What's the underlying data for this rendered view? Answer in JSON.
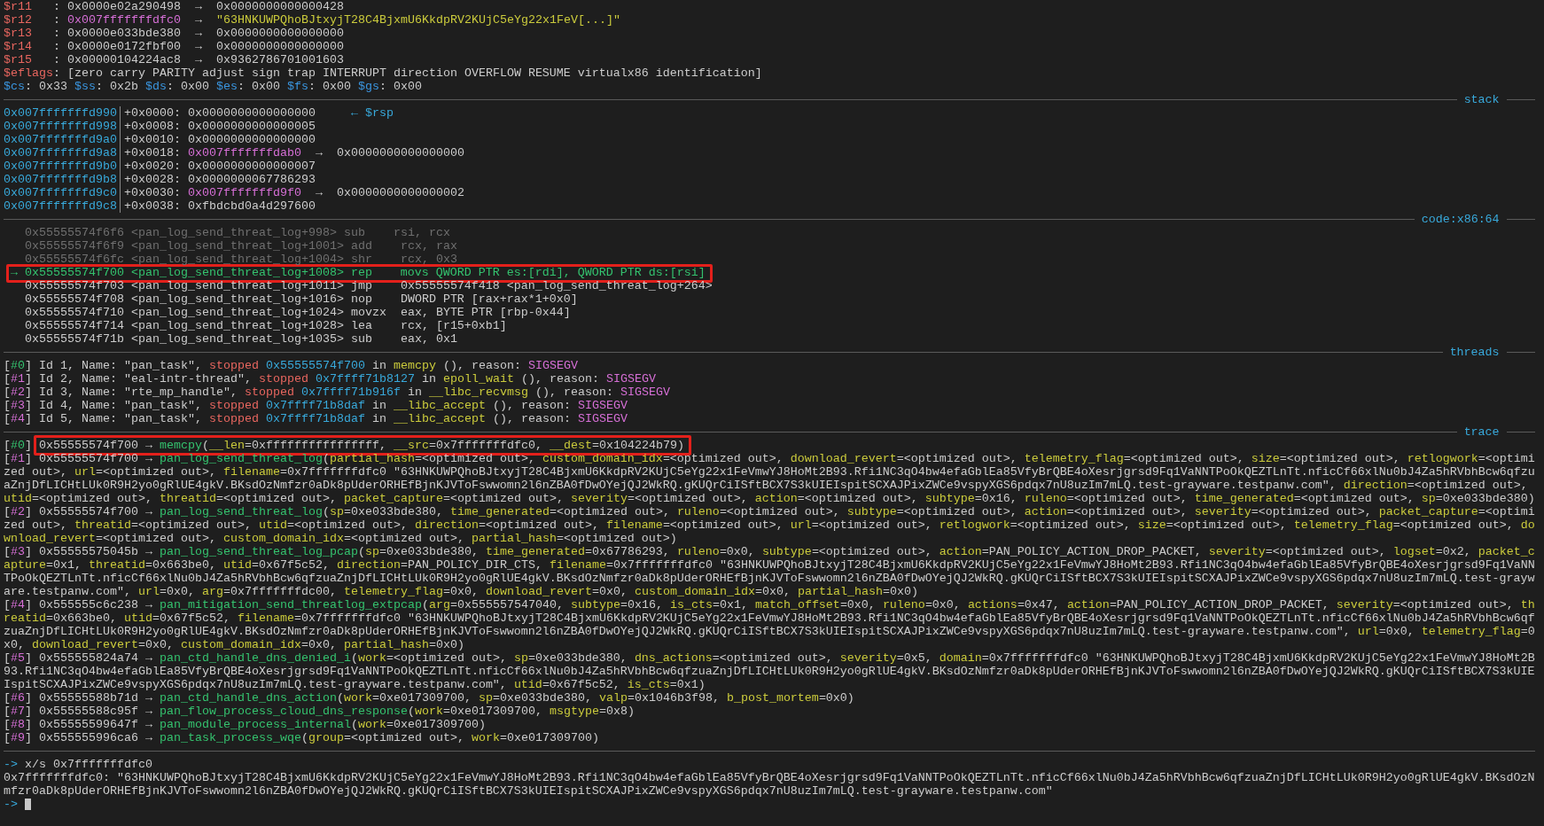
{
  "registers": [
    {
      "name": "$r11",
      "changed": true,
      "segments": [
        {
          "kind": "text",
          "text": "   : 0x0000e02a290498  →  0x0000000000000428"
        }
      ]
    },
    {
      "name": "$r12",
      "changed": true,
      "segments": [
        {
          "kind": "text",
          "text": "   : "
        },
        {
          "kind": "pointer",
          "text": "0x007fffffffdfc0"
        },
        {
          "kind": "text",
          "text": "  →  "
        },
        {
          "kind": "string",
          "text": "\"63HNKUWPQhoBJtxyjT28C4BjxmU6KkdpRV2KUjC5eYg22x1FeV[...]\""
        }
      ]
    },
    {
      "name": "$r13",
      "changed": true,
      "segments": [
        {
          "kind": "text",
          "text": "   : 0x0000e033bde380  →  0x0000000000000000"
        }
      ]
    },
    {
      "name": "$r14",
      "changed": true,
      "segments": [
        {
          "kind": "text",
          "text": "   : 0x0000e0172fbf00  →  0x0000000000000000"
        }
      ]
    },
    {
      "name": "$r15",
      "changed": true,
      "segments": [
        {
          "kind": "text",
          "text": "   : 0x00000104224ac8  →  0x9362786701001603"
        }
      ]
    },
    {
      "name": "$eflags",
      "changed": true,
      "segments": [
        {
          "kind": "text",
          "text": ": [zero carry PARITY adjust sign trap INTERRUPT direction OVERFLOW RESUME virtualx86 identification]"
        }
      ]
    }
  ],
  "segment_registers": [
    {
      "name": "$cs",
      "changed": false,
      "value": ": 0x33"
    },
    {
      "name": "$ss",
      "changed": false,
      "value": ": 0x2b"
    },
    {
      "name": "$ds",
      "changed": false,
      "value": ": 0x00"
    },
    {
      "name": "$es",
      "changed": false,
      "value": ": 0x00"
    },
    {
      "name": "$fs",
      "changed": false,
      "value": ": 0x00"
    },
    {
      "name": "$gs",
      "changed": false,
      "value": ": 0x00"
    }
  ],
  "stack": {
    "title": "stack",
    "rows": [
      {
        "address": "0x007fffffffd990",
        "segments": [
          {
            "kind": "text",
            "text": "+0x0000: 0x0000000000000000"
          },
          {
            "kind": "hint",
            "text": "     ← $rsp"
          }
        ]
      },
      {
        "address": "0x007fffffffd998",
        "segments": [
          {
            "kind": "text",
            "text": "+0x0008: 0x0000000000000005"
          }
        ]
      },
      {
        "address": "0x007fffffffd9a0",
        "segments": [
          {
            "kind": "text",
            "text": "+0x0010: 0x0000000000000000"
          }
        ]
      },
      {
        "address": "0x007fffffffd9a8",
        "segments": [
          {
            "kind": "text",
            "text": "+0x0018: "
          },
          {
            "kind": "pointer",
            "text": "0x007fffffffdab0"
          },
          {
            "kind": "text",
            "text": "  →  0x0000000000000000"
          }
        ]
      },
      {
        "address": "0x007fffffffd9b0",
        "segments": [
          {
            "kind": "text",
            "text": "+0x0020: 0x0000000000000007"
          }
        ]
      },
      {
        "address": "0x007fffffffd9b8",
        "segments": [
          {
            "kind": "text",
            "text": "+0x0028: 0x0000000067786293"
          }
        ]
      },
      {
        "address": "0x007fffffffd9c0",
        "segments": [
          {
            "kind": "text",
            "text": "+0x0030: "
          },
          {
            "kind": "pointer",
            "text": "0x007fffffffd9f0"
          },
          {
            "kind": "text",
            "text": "  →  0x0000000000000002"
          }
        ]
      },
      {
        "address": "0x007fffffffd9c8",
        "segments": [
          {
            "kind": "text",
            "text": "+0x0038: 0xfbdcbd0a4d297600"
          }
        ]
      }
    ]
  },
  "code": {
    "title": "code:x86:64",
    "lines": [
      {
        "executed": true,
        "current": false,
        "highlighted": false,
        "text": "0x55555574f6f6 <pan_log_send_threat_log+998> sub    rsi, rcx"
      },
      {
        "executed": true,
        "current": false,
        "highlighted": false,
        "text": "0x55555574f6f9 <pan_log_send_threat_log+1001> add    rcx, rax"
      },
      {
        "executed": true,
        "current": false,
        "highlighted": false,
        "text": "0x55555574f6fc <pan_log_send_threat_log+1004> shr    rcx, 0x3"
      },
      {
        "executed": false,
        "current": true,
        "highlighted": true,
        "marker": "→",
        "text": "0x55555574f700 <pan_log_send_threat_log+1008> rep    movs QWORD PTR es:[rdi], QWORD PTR ds:[rsi]"
      },
      {
        "executed": false,
        "current": false,
        "highlighted": false,
        "text": "0x55555574f703 <pan_log_send_threat_log+1011> jmp    0x55555574f418 <pan_log_send_threat_log+264>"
      },
      {
        "executed": false,
        "current": false,
        "highlighted": false,
        "text": "0x55555574f708 <pan_log_send_threat_log+1016> nop    DWORD PTR [rax+rax*1+0x0]"
      },
      {
        "executed": false,
        "current": false,
        "highlighted": false,
        "text": "0x55555574f710 <pan_log_send_threat_log+1024> movzx  eax, BYTE PTR [rbp-0x44]"
      },
      {
        "executed": false,
        "current": false,
        "highlighted": false,
        "text": "0x55555574f714 <pan_log_send_threat_log+1028> lea    rcx, [r15+0xb1]"
      },
      {
        "executed": false,
        "current": false,
        "highlighted": false,
        "text": "0x55555574f71b <pan_log_send_threat_log+1035> sub    eax, 0x1"
      }
    ]
  },
  "threads": {
    "title": "threads",
    "lines": [
      {
        "selected": true,
        "index": [
          {
            "kind": "text",
            "text": "["
          },
          {
            "kind": "index",
            "text": "#0"
          },
          {
            "kind": "text",
            "text": "]"
          }
        ],
        "segments": [
          {
            "kind": "text",
            "text": "Id 1, Name: \"pan_task\", "
          },
          {
            "kind": "status",
            "text": "stopped"
          },
          {
            "kind": "address",
            "text": " 0x55555574f700"
          },
          {
            "kind": "text",
            "text": " in "
          },
          {
            "kind": "function",
            "text": "memcpy"
          },
          {
            "kind": "text",
            "text": " (), reason: "
          },
          {
            "kind": "signal",
            "text": "SIGSEGV"
          }
        ]
      },
      {
        "selected": false,
        "index": [
          {
            "kind": "text",
            "text": "["
          },
          {
            "kind": "index",
            "text": "#1"
          },
          {
            "kind": "text",
            "text": "]"
          }
        ],
        "segments": [
          {
            "kind": "text",
            "text": "Id 2, Name: \"eal-intr-thread\", "
          },
          {
            "kind": "status",
            "text": "stopped"
          },
          {
            "kind": "address",
            "text": " 0x7ffff71b8127"
          },
          {
            "kind": "text",
            "text": " in "
          },
          {
            "kind": "function",
            "text": "epoll_wait"
          },
          {
            "kind": "text",
            "text": " (), reason: "
          },
          {
            "kind": "signal",
            "text": "SIGSEGV"
          }
        ]
      },
      {
        "selected": false,
        "index": [
          {
            "kind": "text",
            "text": "["
          },
          {
            "kind": "index",
            "text": "#2"
          },
          {
            "kind": "text",
            "text": "]"
          }
        ],
        "segments": [
          {
            "kind": "text",
            "text": "Id 3, Name: \"rte_mp_handle\", "
          },
          {
            "kind": "status",
            "text": "stopped"
          },
          {
            "kind": "address",
            "text": " 0x7ffff71b916f"
          },
          {
            "kind": "text",
            "text": " in "
          },
          {
            "kind": "function",
            "text": "__libc_recvmsg"
          },
          {
            "kind": "text",
            "text": " (), reason: "
          },
          {
            "kind": "signal",
            "text": "SIGSEGV"
          }
        ]
      },
      {
        "selected": false,
        "index": [
          {
            "kind": "text",
            "text": "["
          },
          {
            "kind": "index",
            "text": "#3"
          },
          {
            "kind": "text",
            "text": "]"
          }
        ],
        "segments": [
          {
            "kind": "text",
            "text": "Id 4, Name: \"pan_task\", "
          },
          {
            "kind": "status",
            "text": "stopped"
          },
          {
            "kind": "address",
            "text": " 0x7ffff71b8daf"
          },
          {
            "kind": "text",
            "text": " in "
          },
          {
            "kind": "function",
            "text": "__libc_accept"
          },
          {
            "kind": "text",
            "text": " (), reason: "
          },
          {
            "kind": "signal",
            "text": "SIGSEGV"
          }
        ]
      },
      {
        "selected": false,
        "index": [
          {
            "kind": "text",
            "text": "["
          },
          {
            "kind": "index",
            "text": "#4"
          },
          {
            "kind": "text",
            "text": "]"
          }
        ],
        "segments": [
          {
            "kind": "text",
            "text": "Id 5, Name: \"pan_task\", "
          },
          {
            "kind": "status",
            "text": "stopped"
          },
          {
            "kind": "address",
            "text": " 0x7ffff71b8daf"
          },
          {
            "kind": "text",
            "text": " in "
          },
          {
            "kind": "function",
            "text": "__libc_accept"
          },
          {
            "kind": "text",
            "text": " (), reason: "
          },
          {
            "kind": "signal",
            "text": "SIGSEGV"
          }
        ]
      }
    ]
  },
  "trace": {
    "title": "trace",
    "frames": [
      {
        "selected": true,
        "highlighted": true,
        "segments": [
          {
            "kind": "text",
            "text": "["
          },
          {
            "kind": "index",
            "text": "#0"
          },
          {
            "kind": "text",
            "text": "] 0x55555574f700 → "
          },
          {
            "kind": "function",
            "text": "memcpy"
          },
          {
            "kind": "text",
            "text": "("
          },
          {
            "kind": "param",
            "text": "__len"
          },
          {
            "kind": "text",
            "text": "=0xffffffffffffffff, "
          },
          {
            "kind": "param",
            "text": "__src"
          },
          {
            "kind": "text",
            "text": "=0x7fffffffdfc0, "
          },
          {
            "kind": "param",
            "text": "__dest"
          },
          {
            "kind": "text",
            "text": "=0x104224b79)"
          }
        ]
      },
      {
        "selected": false,
        "highlighted": false,
        "segments": [
          {
            "kind": "text",
            "text": "["
          },
          {
            "kind": "index",
            "text": "#1"
          },
          {
            "kind": "text",
            "text": "] 0x55555574f700 → "
          },
          {
            "kind": "function",
            "text": "pan_log_send_threat_log"
          },
          {
            "kind": "text",
            "text": "("
          },
          {
            "kind": "param",
            "text": "partial_hash"
          },
          {
            "kind": "text",
            "text": "=<optimized out>, "
          },
          {
            "kind": "param",
            "text": "custom_domain_idx"
          },
          {
            "kind": "text",
            "text": "=<optimized out>, "
          },
          {
            "kind": "param",
            "text": "download_revert"
          },
          {
            "kind": "text",
            "text": "=<optimized out>, "
          },
          {
            "kind": "param",
            "text": "telemetry_flag"
          },
          {
            "kind": "text",
            "text": "=<optimized out>, "
          },
          {
            "kind": "param",
            "text": "size"
          },
          {
            "kind": "text",
            "text": "=<optimized out>, "
          },
          {
            "kind": "param",
            "text": "retlogwork"
          },
          {
            "kind": "text",
            "text": "=<optimized out>, "
          },
          {
            "kind": "param",
            "text": "url"
          },
          {
            "kind": "text",
            "text": "=<optimized out>, "
          },
          {
            "kind": "param",
            "text": "filename"
          },
          {
            "kind": "text",
            "text": "=0x7fffffffdfc0 \"63HNKUWPQhoBJtxyjT28C4BjxmU6KkdpRV2KUjC5eYg22x1FeVmwYJ8HoMt2B93.Rfi1NC3qO4bw4efaGblEa85VfyBrQBE4oXesrjgrsd9Fq1VaNNTPoOkQEZTLnTt.nficCf66xlNu0bJ4Za5hRVbhBcw6qfzuaZnjDfLICHtLUk0R9H2yo0gRlUE4gkV.BKsdOzNmfzr0aDk8pUderORHEfBjnKJVToFswwomn2l6nZBA0fDwOYejQJ2WkRQ.gKUQrCiISftBCX7S3kUIEIspitSCXAJPixZWCe9vspyXGS6pdqx7nU8uzIm7mLQ.test-grayware.testpanw.com\", "
          },
          {
            "kind": "param",
            "text": "direction"
          },
          {
            "kind": "text",
            "text": "=<optimized out>, "
          },
          {
            "kind": "param",
            "text": "utid"
          },
          {
            "kind": "text",
            "text": "=<optimized out>, "
          },
          {
            "kind": "param",
            "text": "threatid"
          },
          {
            "kind": "text",
            "text": "=<optimized out>, "
          },
          {
            "kind": "param",
            "text": "packet_capture"
          },
          {
            "kind": "text",
            "text": "=<optimized out>, "
          },
          {
            "kind": "param",
            "text": "severity"
          },
          {
            "kind": "text",
            "text": "=<optimized out>, "
          },
          {
            "kind": "param",
            "text": "action"
          },
          {
            "kind": "text",
            "text": "=<optimized out>, "
          },
          {
            "kind": "param",
            "text": "subtype"
          },
          {
            "kind": "text",
            "text": "=0x16, "
          },
          {
            "kind": "param",
            "text": "ruleno"
          },
          {
            "kind": "text",
            "text": "=<optimized out>, "
          },
          {
            "kind": "param",
            "text": "time_generated"
          },
          {
            "kind": "text",
            "text": "=<optimized out>, "
          },
          {
            "kind": "param",
            "text": "sp"
          },
          {
            "kind": "text",
            "text": "=0xe033bde380)"
          }
        ]
      },
      {
        "selected": false,
        "highlighted": false,
        "segments": [
          {
            "kind": "text",
            "text": "["
          },
          {
            "kind": "index",
            "text": "#2"
          },
          {
            "kind": "text",
            "text": "] 0x55555574f700 → "
          },
          {
            "kind": "function",
            "text": "pan_log_send_threat_log"
          },
          {
            "kind": "text",
            "text": "("
          },
          {
            "kind": "param",
            "text": "sp"
          },
          {
            "kind": "text",
            "text": "=0xe033bde380, "
          },
          {
            "kind": "param",
            "text": "time_generated"
          },
          {
            "kind": "text",
            "text": "=<optimized out>, "
          },
          {
            "kind": "param",
            "text": "ruleno"
          },
          {
            "kind": "text",
            "text": "=<optimized out>, "
          },
          {
            "kind": "param",
            "text": "subtype"
          },
          {
            "kind": "text",
            "text": "=<optimized out>, "
          },
          {
            "kind": "param",
            "text": "action"
          },
          {
            "kind": "text",
            "text": "=<optimized out>, "
          },
          {
            "kind": "param",
            "text": "severity"
          },
          {
            "kind": "text",
            "text": "=<optimized out>, "
          },
          {
            "kind": "param",
            "text": "packet_capture"
          },
          {
            "kind": "text",
            "text": "=<optimized out>, "
          },
          {
            "kind": "param",
            "text": "threatid"
          },
          {
            "kind": "text",
            "text": "=<optimized out>, "
          },
          {
            "kind": "param",
            "text": "utid"
          },
          {
            "kind": "text",
            "text": "=<optimized out>, "
          },
          {
            "kind": "param",
            "text": "direction"
          },
          {
            "kind": "text",
            "text": "=<optimized out>, "
          },
          {
            "kind": "param",
            "text": "filename"
          },
          {
            "kind": "text",
            "text": "=<optimized out>, "
          },
          {
            "kind": "param",
            "text": "url"
          },
          {
            "kind": "text",
            "text": "=<optimized out>, "
          },
          {
            "kind": "param",
            "text": "retlogwork"
          },
          {
            "kind": "text",
            "text": "=<optimized out>, "
          },
          {
            "kind": "param",
            "text": "size"
          },
          {
            "kind": "text",
            "text": "=<optimized out>, "
          },
          {
            "kind": "param",
            "text": "telemetry_flag"
          },
          {
            "kind": "text",
            "text": "=<optimized out>, "
          },
          {
            "kind": "param",
            "text": "download_revert"
          },
          {
            "kind": "text",
            "text": "=<optimized out>, "
          },
          {
            "kind": "param",
            "text": "custom_domain_idx"
          },
          {
            "kind": "text",
            "text": "=<optimized out>, "
          },
          {
            "kind": "param",
            "text": "partial_hash"
          },
          {
            "kind": "text",
            "text": "=<optimized out>)"
          }
        ]
      },
      {
        "selected": false,
        "highlighted": false,
        "segments": [
          {
            "kind": "text",
            "text": "["
          },
          {
            "kind": "index",
            "text": "#3"
          },
          {
            "kind": "text",
            "text": "] 0x55555575045b → "
          },
          {
            "kind": "function",
            "text": "pan_log_send_threat_log_pcap"
          },
          {
            "kind": "text",
            "text": "("
          },
          {
            "kind": "param",
            "text": "sp"
          },
          {
            "kind": "text",
            "text": "=0xe033bde380, "
          },
          {
            "kind": "param",
            "text": "time_generated"
          },
          {
            "kind": "text",
            "text": "=0x67786293, "
          },
          {
            "kind": "param",
            "text": "ruleno"
          },
          {
            "kind": "text",
            "text": "=0x0, "
          },
          {
            "kind": "param",
            "text": "subtype"
          },
          {
            "kind": "text",
            "text": "=<optimized out>, "
          },
          {
            "kind": "param",
            "text": "action"
          },
          {
            "kind": "text",
            "text": "=PAN_POLICY_ACTION_DROP_PACKET, "
          },
          {
            "kind": "param",
            "text": "severity"
          },
          {
            "kind": "text",
            "text": "=<optimized out>, "
          },
          {
            "kind": "param",
            "text": "logset"
          },
          {
            "kind": "text",
            "text": "=0x2, "
          },
          {
            "kind": "param",
            "text": "packet_capture"
          },
          {
            "kind": "text",
            "text": "=0x1, "
          },
          {
            "kind": "param",
            "text": "threatid"
          },
          {
            "kind": "text",
            "text": "=0x663be0, "
          },
          {
            "kind": "param",
            "text": "utid"
          },
          {
            "kind": "text",
            "text": "=0x67f5c52, "
          },
          {
            "kind": "param",
            "text": "direction"
          },
          {
            "kind": "text",
            "text": "=PAN_POLICY_DIR_CTS, "
          },
          {
            "kind": "param",
            "text": "filename"
          },
          {
            "kind": "text",
            "text": "=0x7fffffffdfc0 \"63HNKUWPQhoBJtxyjT28C4BjxmU6KkdpRV2KUjC5eYg22x1FeVmwYJ8HoMt2B93.Rfi1NC3qO4bw4efaGblEa85VfyBrQBE4oXesrjgrsd9Fq1VaNNTPoOkQEZTLnTt.nficCf66xlNu0bJ4Za5hRVbhBcw6qfzuaZnjDfLICHtLUk0R9H2yo0gRlUE4gkV.BKsdOzNmfzr0aDk8pUderORHEfBjnKJVToFswwomn2l6nZBA0fDwOYejQJ2WkRQ.gKUQrCiISftBCX7S3kUIEIspitSCXAJPixZWCe9vspyXGS6pdqx7nU8uzIm7mLQ.test-grayware.testpanw.com\", "
          },
          {
            "kind": "param",
            "text": "url"
          },
          {
            "kind": "text",
            "text": "=0x0, "
          },
          {
            "kind": "param",
            "text": "arg"
          },
          {
            "kind": "text",
            "text": "=0x7fffffffdc00, "
          },
          {
            "kind": "param",
            "text": "telemetry_flag"
          },
          {
            "kind": "text",
            "text": "=0x0, "
          },
          {
            "kind": "param",
            "text": "download_revert"
          },
          {
            "kind": "text",
            "text": "=0x0, "
          },
          {
            "kind": "param",
            "text": "custom_domain_idx"
          },
          {
            "kind": "text",
            "text": "=0x0, "
          },
          {
            "kind": "param",
            "text": "partial_hash"
          },
          {
            "kind": "text",
            "text": "=0x0)"
          }
        ]
      },
      {
        "selected": false,
        "highlighted": false,
        "segments": [
          {
            "kind": "text",
            "text": "["
          },
          {
            "kind": "index",
            "text": "#4"
          },
          {
            "kind": "text",
            "text": "] 0x555555c6c238 → "
          },
          {
            "kind": "function",
            "text": "pan_mitigation_send_threatlog_extpcap"
          },
          {
            "kind": "text",
            "text": "("
          },
          {
            "kind": "param",
            "text": "arg"
          },
          {
            "kind": "text",
            "text": "=0x555557547040, "
          },
          {
            "kind": "param",
            "text": "subtype"
          },
          {
            "kind": "text",
            "text": "=0x16, "
          },
          {
            "kind": "param",
            "text": "is_cts"
          },
          {
            "kind": "text",
            "text": "=0x1, "
          },
          {
            "kind": "param",
            "text": "match_offset"
          },
          {
            "kind": "text",
            "text": "=0x0, "
          },
          {
            "kind": "param",
            "text": "ruleno"
          },
          {
            "kind": "text",
            "text": "=0x0, "
          },
          {
            "kind": "param",
            "text": "actions"
          },
          {
            "kind": "text",
            "text": "=0x47, "
          },
          {
            "kind": "param",
            "text": "action"
          },
          {
            "kind": "text",
            "text": "=PAN_POLICY_ACTION_DROP_PACKET, "
          },
          {
            "kind": "param",
            "text": "severity"
          },
          {
            "kind": "text",
            "text": "=<optimized out>, "
          },
          {
            "kind": "param",
            "text": "threatid"
          },
          {
            "kind": "text",
            "text": "=0x663be0, "
          },
          {
            "kind": "param",
            "text": "utid"
          },
          {
            "kind": "text",
            "text": "=0x67f5c52, "
          },
          {
            "kind": "param",
            "text": "filename"
          },
          {
            "kind": "text",
            "text": "=0x7fffffffdfc0 \"63HNKUWPQhoBJtxyjT28C4BjxmU6KkdpRV2KUjC5eYg22x1FeVmwYJ8HoMt2B93.Rfi1NC3qO4bw4efaGblEa85VfyBrQBE4oXesrjgrsd9Fq1VaNNTPoOkQEZTLnTt.nficCf66xlNu0bJ4Za5hRVbhBcw6qfzuaZnjDfLICHtLUk0R9H2yo0gRlUE4gkV.BKsdOzNmfzr0aDk8pUderORHEfBjnKJVToFswwomn2l6nZBA0fDwOYejQJ2WkRQ.gKUQrCiISftBCX7S3kUIEIspitSCXAJPixZWCe9vspyXGS6pdqx7nU8uzIm7mLQ.test-grayware.testpanw.com\", "
          },
          {
            "kind": "param",
            "text": "url"
          },
          {
            "kind": "text",
            "text": "=0x0, "
          },
          {
            "kind": "param",
            "text": "telemetry_flag"
          },
          {
            "kind": "text",
            "text": "=0x0, "
          },
          {
            "kind": "param",
            "text": "download_revert"
          },
          {
            "kind": "text",
            "text": "=0x0, "
          },
          {
            "kind": "param",
            "text": "custom_domain_idx"
          },
          {
            "kind": "text",
            "text": "=0x0, "
          },
          {
            "kind": "param",
            "text": "partial_hash"
          },
          {
            "kind": "text",
            "text": "=0x0)"
          }
        ]
      },
      {
        "selected": false,
        "highlighted": false,
        "segments": [
          {
            "kind": "text",
            "text": "["
          },
          {
            "kind": "index",
            "text": "#5"
          },
          {
            "kind": "text",
            "text": "] 0x555555824a74 → "
          },
          {
            "kind": "function",
            "text": "pan_ctd_handle_dns_denied_i"
          },
          {
            "kind": "text",
            "text": "("
          },
          {
            "kind": "param",
            "text": "work"
          },
          {
            "kind": "text",
            "text": "=<optimized out>, "
          },
          {
            "kind": "param",
            "text": "sp"
          },
          {
            "kind": "text",
            "text": "=0xe033bde380, "
          },
          {
            "kind": "param",
            "text": "dns_actions"
          },
          {
            "kind": "text",
            "text": "=<optimized out>, "
          },
          {
            "kind": "param",
            "text": "severity"
          },
          {
            "kind": "text",
            "text": "=0x5, "
          },
          {
            "kind": "param",
            "text": "domain"
          },
          {
            "kind": "text",
            "text": "=0x7fffffffdfc0 \"63HNKUWPQhoBJtxyjT28C4BjxmU6KkdpRV2KUjC5eYg22x1FeVmwYJ8HoMt2B93.Rfi1NC3qO4bw4efaGblEa85VfyBrQBE4oXesrjgrsd9Fq1VaNNTPoOkQEZTLnTt.nficCf66xlNu0bJ4Za5hRVbhBcw6qfzuaZnjDfLICHtLUk0R9H2yo0gRlUE4gkV.BKsdOzNmfzr0aDk8pUderORHEfBjnKJVToFswwomn2l6nZBA0fDwOYejQJ2WkRQ.gKUQrCiISftBCX7S3kUIEIspitSCXAJPixZWCe9vspyXGS6pdqx7nU8uzIm7mLQ.test-grayware.testpanw.com\", "
          },
          {
            "kind": "param",
            "text": "utid"
          },
          {
            "kind": "text",
            "text": "=0x67f5c52, "
          },
          {
            "kind": "param",
            "text": "is_cts"
          },
          {
            "kind": "text",
            "text": "=0x1)"
          }
        ]
      },
      {
        "selected": false,
        "highlighted": false,
        "segments": [
          {
            "kind": "text",
            "text": "["
          },
          {
            "kind": "index",
            "text": "#6"
          },
          {
            "kind": "text",
            "text": "] 0x55555588b71d → "
          },
          {
            "kind": "function",
            "text": "pan_ctd_handle_dns_action"
          },
          {
            "kind": "text",
            "text": "("
          },
          {
            "kind": "param",
            "text": "work"
          },
          {
            "kind": "text",
            "text": "=0xe017309700, "
          },
          {
            "kind": "param",
            "text": "sp"
          },
          {
            "kind": "text",
            "text": "=0xe033bde380, "
          },
          {
            "kind": "param",
            "text": "valp"
          },
          {
            "kind": "text",
            "text": "=0x1046b3f98, "
          },
          {
            "kind": "param",
            "text": "b_post_mortem"
          },
          {
            "kind": "text",
            "text": "=0x0)"
          }
        ]
      },
      {
        "selected": false,
        "highlighted": false,
        "segments": [
          {
            "kind": "text",
            "text": "["
          },
          {
            "kind": "index",
            "text": "#7"
          },
          {
            "kind": "text",
            "text": "] 0x55555588c95f → "
          },
          {
            "kind": "function",
            "text": "pan_flow_process_cloud_dns_response"
          },
          {
            "kind": "text",
            "text": "("
          },
          {
            "kind": "param",
            "text": "work"
          },
          {
            "kind": "text",
            "text": "=0xe017309700, "
          },
          {
            "kind": "param",
            "text": "msgtype"
          },
          {
            "kind": "text",
            "text": "=0x8)"
          }
        ]
      },
      {
        "selected": false,
        "highlighted": false,
        "segments": [
          {
            "kind": "text",
            "text": "["
          },
          {
            "kind": "index",
            "text": "#8"
          },
          {
            "kind": "text",
            "text": "] 0x55555599647f → "
          },
          {
            "kind": "function",
            "text": "pan_module_process_internal"
          },
          {
            "kind": "text",
            "text": "("
          },
          {
            "kind": "param",
            "text": "work"
          },
          {
            "kind": "text",
            "text": "=0xe017309700)"
          }
        ]
      },
      {
        "selected": false,
        "highlighted": false,
        "segments": [
          {
            "kind": "text",
            "text": "["
          },
          {
            "kind": "index",
            "text": "#9"
          },
          {
            "kind": "text",
            "text": "] 0x555555996ca6 → "
          },
          {
            "kind": "function",
            "text": "pan_task_process_wqe"
          },
          {
            "kind": "text",
            "text": "("
          },
          {
            "kind": "param",
            "text": "group"
          },
          {
            "kind": "text",
            "text": "=<optimized out>, "
          },
          {
            "kind": "param",
            "text": "work"
          },
          {
            "kind": "text",
            "text": "=0xe017309700)"
          }
        ]
      }
    ]
  },
  "console": {
    "command": {
      "prompt": "->",
      "text": "x/s 0x7fffffffdfc0"
    },
    "output": "0x7fffffffdfc0: \"63HNKUWPQhoBJtxyjT28C4BjxmU6KkdpRV2KUjC5eYg22x1FeVmwYJ8HoMt2B93.Rfi1NC3qO4bw4efaGblEa85VfyBrQBE4oXesrjgrsd9Fq1VaNNTPoOkQEZTLnTt.nficCf66xlNu0bJ4Za5hRVbhBcw6qfzuaZnjDfLICHtLUk0R9H2yo0gRlUE4gkV.BKsdOzNmfzr0aDk8pUderORHEfBjnKJVToFswwomn2l6nZBA0fDwOYejQJ2WkRQ.gKUQrCiISftBCX7S3kUIEIspitSCXAJPixZWCe9vspyXGS6pdqx7nU8uzIm7mLQ.test-grayware.testpanw.com\"",
    "input": {
      "prompt": "->",
      "cursor": true
    }
  }
}
